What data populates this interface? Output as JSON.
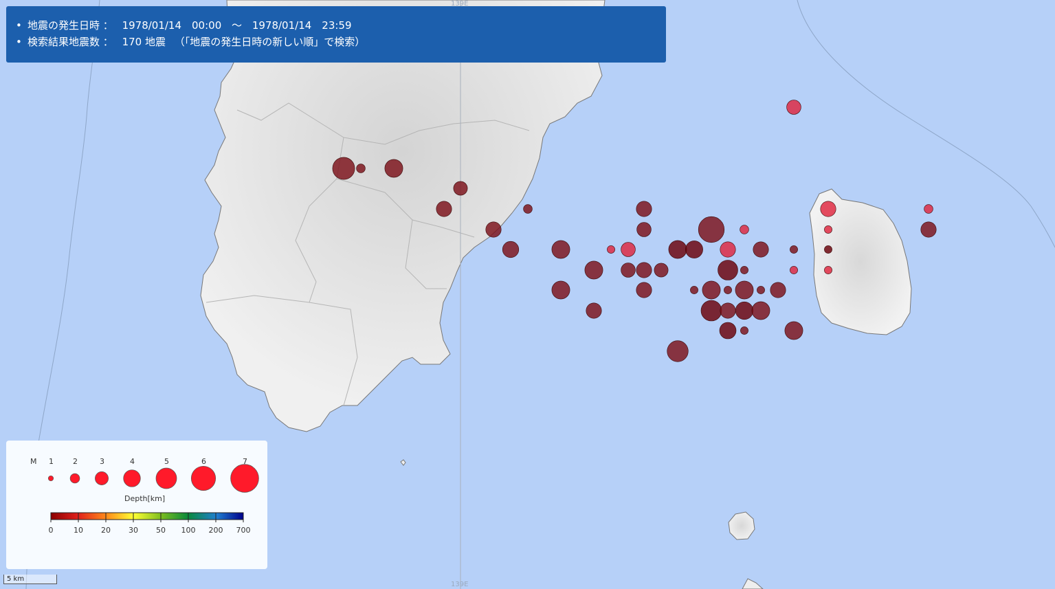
{
  "header": {
    "line1_label": "地震の発生日時 ：",
    "line1_start": "1978/01/14　00:00",
    "line1_sep": "～",
    "line1_end": "1978/01/14　23:59",
    "line2_label": "検索結果地震数 ：",
    "line2_count": "170 地震",
    "line2_note": "（「地震の発生日時の新しい順」で検索）"
  },
  "map": {
    "meridian_label": "139E",
    "scale_label": "5 km",
    "land_color": "#eeeeee",
    "sea_color": "#b6d0f8"
  },
  "legend": {
    "magnitude_label": "M",
    "magnitudes": [
      "1",
      "2",
      "3",
      "4",
      "5",
      "6",
      "7"
    ],
    "depth_title": "Depth[km]",
    "depth_ticks": [
      "0",
      "10",
      "20",
      "30",
      "50",
      "100",
      "200",
      "700"
    ],
    "depth_colors": [
      "#8b0000",
      "#e0201b",
      "#ff8c1a",
      "#ffff33",
      "#7fbf1f",
      "#0a8a3a",
      "#1f7fd0",
      "#00008b"
    ],
    "marker_color": "#ff1a2a"
  },
  "earthquakes": [
    {
      "m": 5.4,
      "depth": "shallow"
    },
    {
      "m": 1.8,
      "depth": "shallow"
    },
    {
      "m": 4.3,
      "depth": "shallow"
    },
    {
      "m": 3.2,
      "depth": "shallow"
    },
    {
      "m": 3.6,
      "depth": "shallow"
    },
    {
      "m": 1.8,
      "depth": "shallow"
    },
    {
      "m": 3.6,
      "depth": "shallow"
    },
    {
      "m": 3.8,
      "depth": "shallow"
    },
    {
      "m": 4.3,
      "depth": "shallow"
    },
    {
      "m": 4.3,
      "depth": "shallow"
    },
    {
      "m": 3.3,
      "depth": "shallow"
    },
    {
      "m": 1.5,
      "depth": "mid"
    },
    {
      "m": 3.3,
      "depth": "mid"
    },
    {
      "m": 4.3,
      "depth": "deep"
    },
    {
      "m": 4.1,
      "depth": "deep"
    },
    {
      "m": 6.4,
      "depth": "shallow"
    },
    {
      "m": 3.6,
      "depth": "shallow"
    },
    {
      "m": 3.3,
      "depth": "shallow"
    },
    {
      "m": 4.3,
      "depth": "shallow"
    },
    {
      "m": 3.6,
      "depth": "shallow"
    },
    {
      "m": 3.6,
      "depth": "shallow"
    },
    {
      "m": 3.2,
      "depth": "shallow"
    },
    {
      "m": 3.6,
      "depth": "shallow"
    },
    {
      "m": 3.6,
      "depth": "mid"
    },
    {
      "m": 5.0,
      "depth": "deep"
    },
    {
      "m": 1.8,
      "depth": "mid"
    },
    {
      "m": 3.6,
      "depth": "shallow"
    },
    {
      "m": 1.5,
      "depth": "shallow"
    },
    {
      "m": 4.3,
      "depth": "shallow"
    },
    {
      "m": 1.5,
      "depth": "shallow"
    },
    {
      "m": 4.8,
      "depth": "deep"
    },
    {
      "m": 1.5,
      "depth": "shallow"
    },
    {
      "m": 4.3,
      "depth": "shallow"
    },
    {
      "m": 4.2,
      "depth": "deep"
    },
    {
      "m": 3.6,
      "depth": "shallow"
    },
    {
      "m": 3.6,
      "depth": "shallow"
    },
    {
      "m": 1.5,
      "depth": "shallow"
    },
    {
      "m": 3.9,
      "depth": "deep"
    },
    {
      "m": 1.5,
      "depth": "shallow"
    },
    {
      "m": 4.3,
      "depth": "shallow"
    },
    {
      "m": 5.1,
      "depth": "shallow"
    },
    {
      "m": 3.6,
      "depth": "mid"
    },
    {
      "m": 1.5,
      "depth": "mid"
    },
    {
      "m": 3.6,
      "depth": "shallow"
    },
    {
      "m": 1.5,
      "depth": "shallow"
    },
    {
      "m": 1.5,
      "depth": "mid"
    },
    {
      "m": 1.5,
      "depth": "deep"
    },
    {
      "m": 1.5,
      "depth": "mid"
    },
    {
      "m": 1.8,
      "depth": "mid"
    },
    {
      "m": 3.3,
      "depth": "mid"
    },
    {
      "m": 4.3,
      "depth": "shallow"
    }
  ]
}
